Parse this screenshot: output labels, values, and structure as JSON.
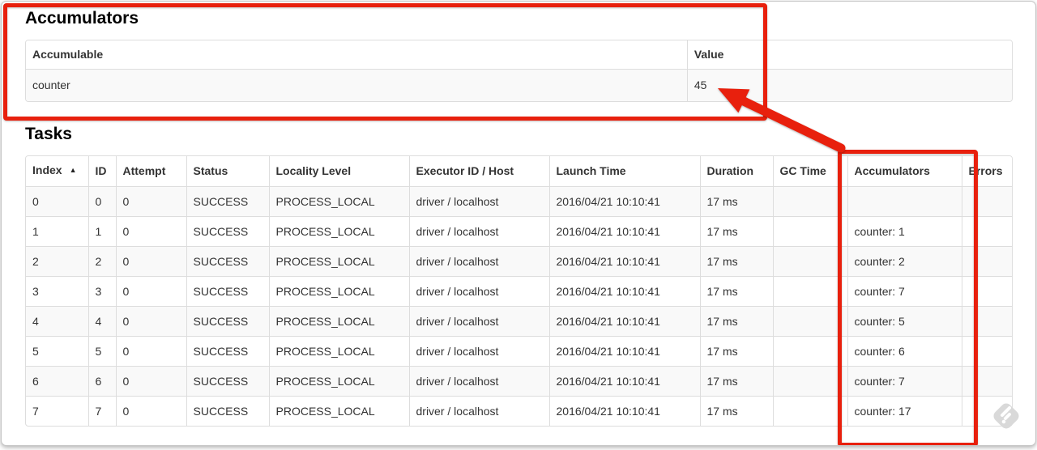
{
  "accumulators_section": {
    "heading": "Accumulators",
    "table": {
      "columns": [
        "Accumulable",
        "Value"
      ],
      "rows": [
        {
          "accumulable": "counter",
          "value": "45"
        }
      ]
    }
  },
  "tasks_section": {
    "heading": "Tasks",
    "table": {
      "columns": [
        "Index",
        "ID",
        "Attempt",
        "Status",
        "Locality Level",
        "Executor ID / Host",
        "Launch Time",
        "Duration",
        "GC Time",
        "Accumulators",
        "Errors"
      ],
      "sorted_column": "Index",
      "sort_direction": "ascending",
      "sort_indicator": "▲",
      "rows": [
        {
          "index": "0",
          "id": "0",
          "attempt": "0",
          "status": "SUCCESS",
          "locality_level": "PROCESS_LOCAL",
          "executor_id_host": "driver / localhost",
          "launch_time": "2016/04/21 10:10:41",
          "duration": "17 ms",
          "gc_time": "",
          "accumulators": "",
          "errors": ""
        },
        {
          "index": "1",
          "id": "1",
          "attempt": "0",
          "status": "SUCCESS",
          "locality_level": "PROCESS_LOCAL",
          "executor_id_host": "driver / localhost",
          "launch_time": "2016/04/21 10:10:41",
          "duration": "17 ms",
          "gc_time": "",
          "accumulators": "counter: 1",
          "errors": ""
        },
        {
          "index": "2",
          "id": "2",
          "attempt": "0",
          "status": "SUCCESS",
          "locality_level": "PROCESS_LOCAL",
          "executor_id_host": "driver / localhost",
          "launch_time": "2016/04/21 10:10:41",
          "duration": "17 ms",
          "gc_time": "",
          "accumulators": "counter: 2",
          "errors": ""
        },
        {
          "index": "3",
          "id": "3",
          "attempt": "0",
          "status": "SUCCESS",
          "locality_level": "PROCESS_LOCAL",
          "executor_id_host": "driver / localhost",
          "launch_time": "2016/04/21 10:10:41",
          "duration": "17 ms",
          "gc_time": "",
          "accumulators": "counter: 7",
          "errors": ""
        },
        {
          "index": "4",
          "id": "4",
          "attempt": "0",
          "status": "SUCCESS",
          "locality_level": "PROCESS_LOCAL",
          "executor_id_host": "driver / localhost",
          "launch_time": "2016/04/21 10:10:41",
          "duration": "17 ms",
          "gc_time": "",
          "accumulators": "counter: 5",
          "errors": ""
        },
        {
          "index": "5",
          "id": "5",
          "attempt": "0",
          "status": "SUCCESS",
          "locality_level": "PROCESS_LOCAL",
          "executor_id_host": "driver / localhost",
          "launch_time": "2016/04/21 10:10:41",
          "duration": "17 ms",
          "gc_time": "",
          "accumulators": "counter: 6",
          "errors": ""
        },
        {
          "index": "6",
          "id": "6",
          "attempt": "0",
          "status": "SUCCESS",
          "locality_level": "PROCESS_LOCAL",
          "executor_id_host": "driver / localhost",
          "launch_time": "2016/04/21 10:10:41",
          "duration": "17 ms",
          "gc_time": "",
          "accumulators": "counter: 7",
          "errors": ""
        },
        {
          "index": "7",
          "id": "7",
          "attempt": "0",
          "status": "SUCCESS",
          "locality_level": "PROCESS_LOCAL",
          "executor_id_host": "driver / localhost",
          "launch_time": "2016/04/21 10:10:41",
          "duration": "17 ms",
          "gc_time": "",
          "accumulators": "counter: 17",
          "errors": ""
        }
      ]
    }
  },
  "annotations": {
    "color": "#e8200d",
    "box_accumulators_section": "highlight around Accumulators summary table",
    "box_accumulators_column": "highlight around Accumulators task column",
    "arrow_target_value": "45"
  },
  "colors": {
    "annotation_red": "#e8200d",
    "table_border": "#dddddd",
    "row_stripe": "#f9f9f9",
    "text": "#333333",
    "watermark_gray": "#d9d9d9",
    "frame_border": "#c6c6c6"
  },
  "icons": {
    "sort_ascending_icon": "▲",
    "watermark_stamp_icon": "rounded-diamond-stamp"
  }
}
